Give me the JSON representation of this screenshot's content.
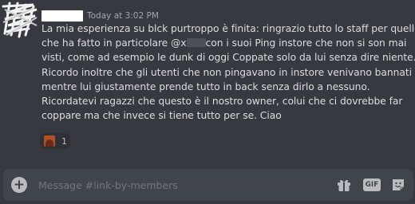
{
  "message": {
    "timestamp": "Today at 3:02 PM",
    "lines": [
      "La mia esperienza su blck purtroppo è finita: ringrazio tutto lo staff per quello",
      "che ha fatto in particolare @x",
      "con i suoi Ping instore che non si son mai",
      "visti, come ad esempio le dunk di oggi Coppate solo da lui senza dire niente.",
      "Ricordo inoltre che gli utenti che non pingavano in instore venivano bannati",
      "mentre lui giustamente prende tutto in back senza dirlo a nessuno.",
      "Ricordatevi ragazzi che questo è il nostro owner, colui che ci dovrebbe far",
      "coppare ma che invece si tiene tutto per se. Ciao"
    ]
  },
  "reaction": {
    "emoji_icon": "custom-emoji-icon",
    "count": "1"
  },
  "composer": {
    "placeholder": "Message #link-by-members",
    "value": ""
  },
  "toolbar": {
    "add_icon": "plus-circle-icon",
    "gift_icon": "gift-icon",
    "gif_label": "GIF",
    "sticker_icon": "sticker-icon"
  },
  "colors": {
    "background": "#36393f",
    "composer": "#40444b",
    "text": "#dcddde",
    "muted": "#72767d",
    "icon": "#b9bbbe"
  }
}
